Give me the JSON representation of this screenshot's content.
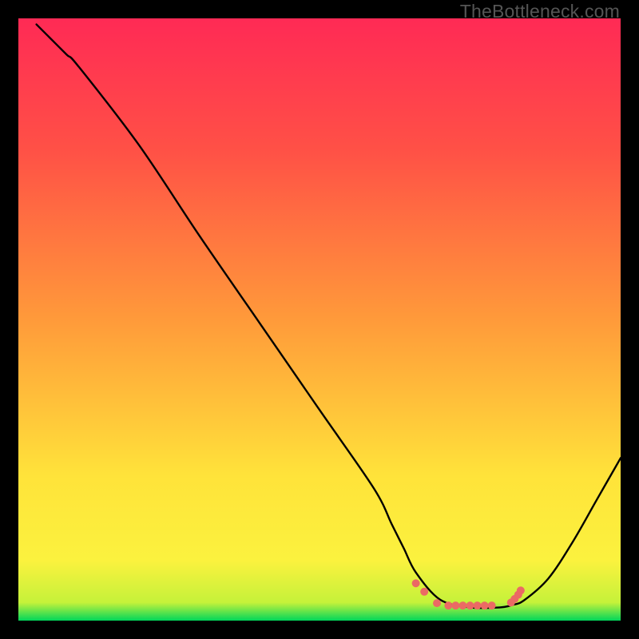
{
  "watermark": "TheBottleneck.com",
  "chart_data": {
    "type": "line",
    "title": "",
    "xlabel": "",
    "ylabel": "",
    "xlim": [
      0,
      100
    ],
    "ylim": [
      0,
      100
    ],
    "grid": false,
    "legend": false,
    "gradient_stops": [
      {
        "offset": 0,
        "color": "#00d65a"
      },
      {
        "offset": 3,
        "color": "#c5f23a"
      },
      {
        "offset": 10,
        "color": "#fbf23e"
      },
      {
        "offset": 24,
        "color": "#ffe33a"
      },
      {
        "offset": 50,
        "color": "#ff9a3a"
      },
      {
        "offset": 78,
        "color": "#ff5146"
      },
      {
        "offset": 100,
        "color": "#ff2a55"
      }
    ],
    "series": [
      {
        "name": "curve",
        "x": [
          3,
          5,
          8,
          10,
          20,
          30,
          40,
          50,
          59,
          62,
          64,
          66,
          70,
          75,
          80,
          82,
          84,
          88,
          92,
          96,
          100
        ],
        "y": [
          99,
          97,
          94,
          92,
          79,
          64,
          49.5,
          35,
          22,
          16,
          12,
          8,
          3.5,
          2.2,
          2.2,
          2.6,
          3.4,
          7,
          13,
          20,
          27
        ]
      }
    ],
    "markers": {
      "name": "low-region-dots",
      "color": "#eb6a64",
      "radius": 5,
      "points": [
        {
          "x": 66.0,
          "y": 6.2
        },
        {
          "x": 67.4,
          "y": 4.8
        },
        {
          "x": 69.5,
          "y": 2.9
        },
        {
          "x": 71.4,
          "y": 2.5
        },
        {
          "x": 72.6,
          "y": 2.5
        },
        {
          "x": 73.8,
          "y": 2.5
        },
        {
          "x": 75.0,
          "y": 2.5
        },
        {
          "x": 76.2,
          "y": 2.5
        },
        {
          "x": 77.4,
          "y": 2.5
        },
        {
          "x": 78.6,
          "y": 2.5
        },
        {
          "x": 81.8,
          "y": 3.0
        },
        {
          "x": 82.4,
          "y": 3.6
        },
        {
          "x": 83.0,
          "y": 4.3
        },
        {
          "x": 83.4,
          "y": 5.0
        }
      ]
    }
  }
}
